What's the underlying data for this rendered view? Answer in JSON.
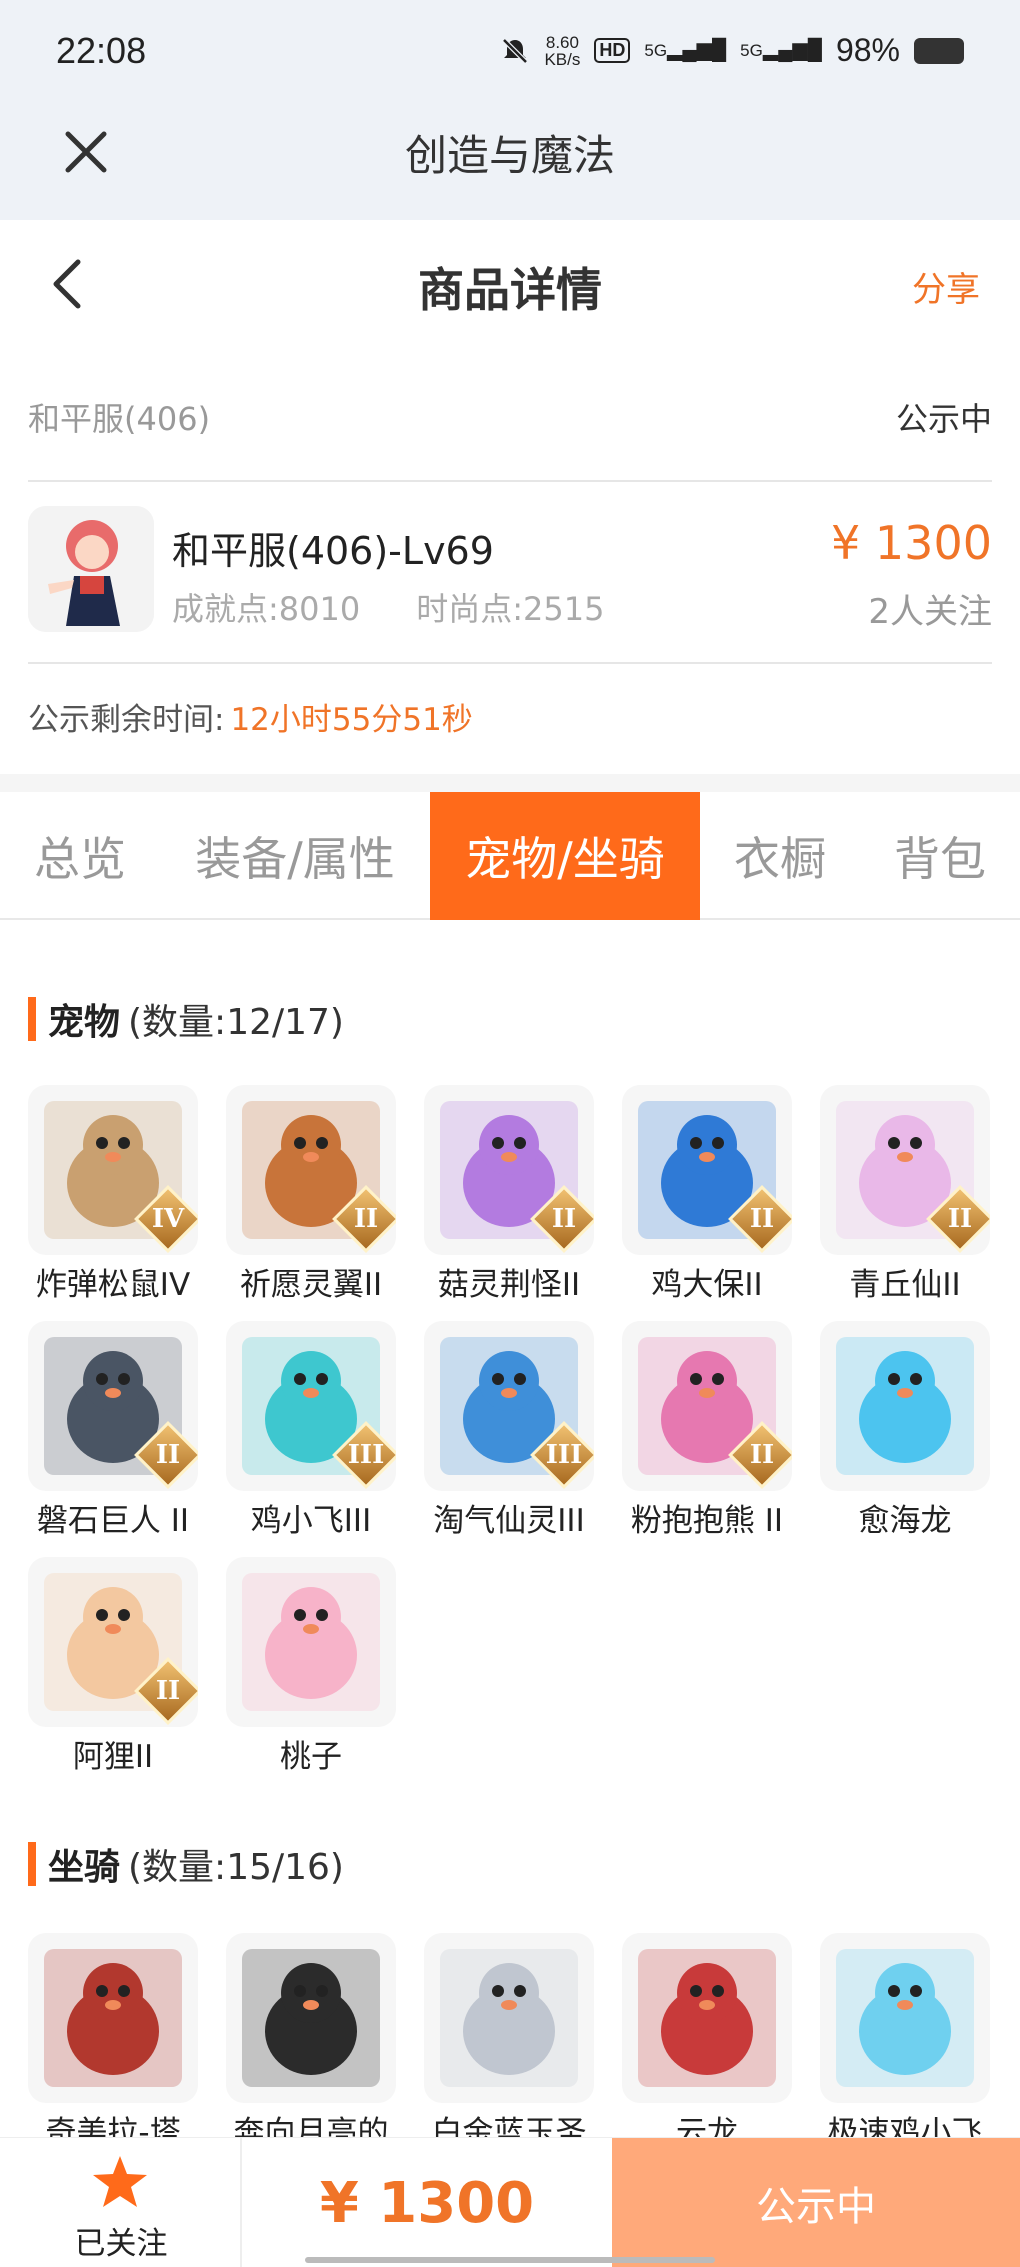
{
  "status_bar": {
    "time": "22:08",
    "net_speed_value": "8.60",
    "net_speed_unit": "KB/s",
    "hd_label": "HD",
    "signal1": "5G",
    "signal2": "5G",
    "battery": "98%"
  },
  "app_bar": {
    "title": "创造与魔法"
  },
  "nav": {
    "title": "商品详情",
    "share": "分享"
  },
  "server": {
    "name": "和平服(406)",
    "status": "公示中"
  },
  "product": {
    "name": "和平服(406)-Lv69",
    "achievement": "成就点:8010",
    "fashion": "时尚点:2515",
    "price": "¥ 1300",
    "followers": "2人关注"
  },
  "countdown": {
    "label": "公示剩余时间:",
    "value": "12小时55分51秒"
  },
  "tabs": [
    "总览",
    "装备/属性",
    "宠物/坐骑",
    "衣橱",
    "背包"
  ],
  "active_tab": "宠物/坐骑",
  "pets": {
    "title": "宠物",
    "count": "(数量:12/17)",
    "items": [
      {
        "label": "炸弹松鼠IV",
        "badge": "IV",
        "icon": "squirrel-icon",
        "color": "#c9a070"
      },
      {
        "label": "祈愿灵翼II",
        "badge": "II",
        "icon": "eagle-icon",
        "color": "#c8743a"
      },
      {
        "label": "菇灵荆怪II",
        "badge": "II",
        "icon": "mushroom-sprite-icon",
        "color": "#b37be0"
      },
      {
        "label": "鸡大保II",
        "badge": "II",
        "icon": "blue-chicken-icon",
        "color": "#2f7ad6"
      },
      {
        "label": "青丘仙II",
        "badge": "II",
        "icon": "fox-fairy-icon",
        "color": "#e9b8e8"
      },
      {
        "label": "磐石巨人 II",
        "badge": "II",
        "icon": "stone-giant-icon",
        "color": "#4a5564"
      },
      {
        "label": "鸡小飞III",
        "badge": "III",
        "icon": "chick-icon",
        "color": "#3ec7cf"
      },
      {
        "label": "淘气仙灵III",
        "badge": "III",
        "icon": "blue-dog-icon",
        "color": "#3f8fd9"
      },
      {
        "label": "粉抱抱熊 II",
        "badge": "II",
        "icon": "pink-bear-icon",
        "color": "#e678b0"
      },
      {
        "label": "愈海龙",
        "badge": "",
        "icon": "sea-dragon-icon",
        "color": "#4cc4ef"
      },
      {
        "label": "阿狸II",
        "badge": "II",
        "icon": "fox-doll-icon",
        "color": "#f3c8a0"
      },
      {
        "label": "桃子",
        "badge": "",
        "icon": "pink-bunny-icon",
        "color": "#f7b3c9"
      }
    ]
  },
  "mounts": {
    "title": "坐骑",
    "count": "(数量:15/16)",
    "items": [
      {
        "label": "奇美拉-塔",
        "icon": "chimera-icon",
        "color": "#b2382e"
      },
      {
        "label": "奔向月亮的",
        "icon": "pig-mount-icon",
        "color": "#2b2b2b"
      },
      {
        "label": "白金蓝玉圣",
        "icon": "platinum-beast-icon",
        "color": "#c0c6d0"
      },
      {
        "label": "云龙",
        "icon": "cloud-dragon-icon",
        "color": "#c83a3a"
      },
      {
        "label": "极速鸡小飞",
        "icon": "fast-chick-icon",
        "color": "#6fd0ef"
      }
    ]
  },
  "bottom_bar": {
    "follow_label": "已关注",
    "price": "¥ 1300",
    "action": "公示中"
  },
  "colors": {
    "accent": "#ff6a1a",
    "price": "#f07428",
    "action_bg": "#ffa97a"
  }
}
